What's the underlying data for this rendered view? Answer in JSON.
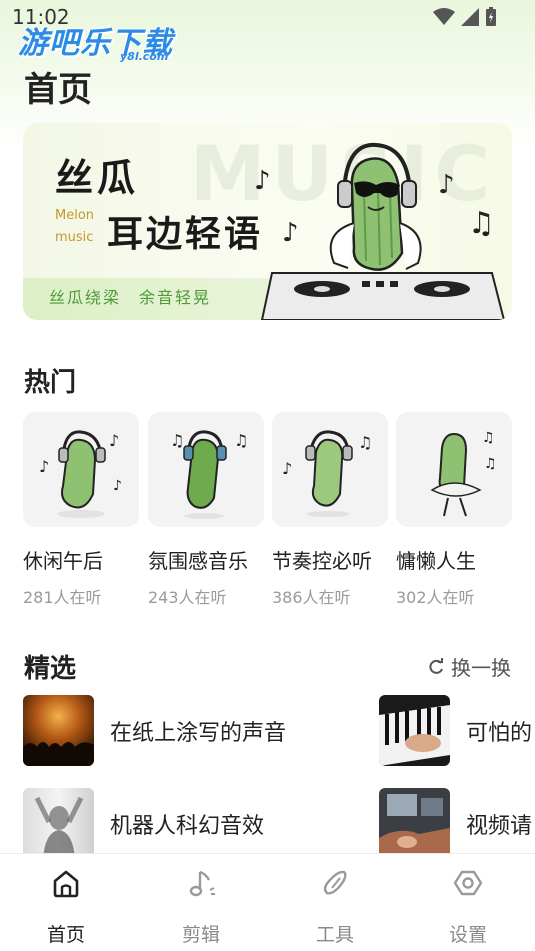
{
  "status_bar": {
    "time": "11:02"
  },
  "watermark": {
    "main": "游吧乐下载",
    "sub": "y8l.com"
  },
  "page": {
    "title": "首页"
  },
  "banner": {
    "bg_text": "MUSIC",
    "title_line1": "丝瓜",
    "title_line2": "耳边轻语",
    "en_line1": "Melon",
    "en_line2": "music",
    "slogan": "丝瓜绕梁　余音轻晃"
  },
  "hot": {
    "title": "热门",
    "items": [
      {
        "name": "休闲午后",
        "count": "281人在听"
      },
      {
        "name": "氛围感音乐",
        "count": "243人在听"
      },
      {
        "name": "节奏控必听",
        "count": "386人在听"
      },
      {
        "name": "慵懒人生",
        "count": "302人在听"
      }
    ]
  },
  "featured": {
    "title": "精选",
    "refresh_label": "换一换",
    "items": [
      {
        "label": "在纸上涂写的声音"
      },
      {
        "label": "可怕的"
      },
      {
        "label": "机器人科幻音效"
      },
      {
        "label": "视频请"
      }
    ]
  },
  "nav": {
    "items": [
      {
        "label": "首页",
        "icon": "home-icon"
      },
      {
        "label": "剪辑",
        "icon": "music-note-icon"
      },
      {
        "label": "工具",
        "icon": "tools-icon"
      },
      {
        "label": "设置",
        "icon": "settings-icon"
      }
    ]
  }
}
